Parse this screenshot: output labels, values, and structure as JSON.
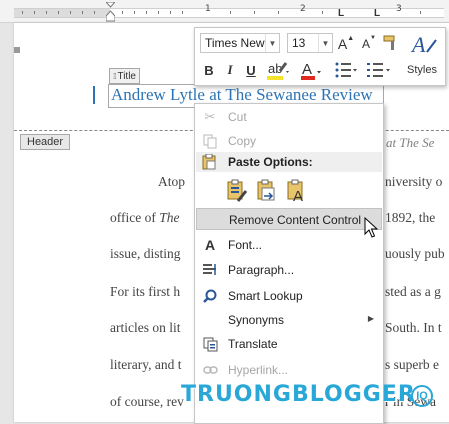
{
  "ruler": {
    "numbers": [
      "1",
      "2",
      "3"
    ],
    "tab_marks": [
      "L",
      "L"
    ]
  },
  "document": {
    "title_tag": "Title",
    "title_text": "Andrew Lytle at The Sewanee Review",
    "header_tag": "Header",
    "header_right": "at The Se",
    "body_lines": [
      {
        "left": "Atop",
        "right": "niversity o"
      },
      {
        "left_pre": "office of ",
        "left_italic": "The",
        "right": "1892, the"
      },
      {
        "left": "issue, disting",
        "right": "uously pub"
      },
      {
        "left": "For its first h",
        "right": "sted as a g"
      },
      {
        "left": "articles on lit",
        "right": "South. In t"
      },
      {
        "left": "literary, and t",
        "right": "s superb e"
      },
      {
        "left": "of course, rev",
        "right": "r in Sewa"
      }
    ]
  },
  "mini_toolbar": {
    "font_name": "Times New Ro",
    "font_size": "13",
    "grow_font": "A",
    "shrink_font": "A",
    "bold": "B",
    "italic": "I",
    "underline": "U",
    "highlight_color": "#f5e22a",
    "font_color": "#e02b20",
    "styles_label": "Styles"
  },
  "context_menu": {
    "items": [
      {
        "label": "Cut",
        "icon": "scissors-icon",
        "enabled": false
      },
      {
        "label": "Copy",
        "icon": "copy-icon",
        "enabled": false
      },
      {
        "label": "Paste Options:",
        "icon": "clipboard-icon",
        "header": true
      },
      {
        "label": "Remove Content Control",
        "icon": "",
        "highlighted": true
      },
      {
        "label": "Font...",
        "icon": "font-icon"
      },
      {
        "label": "Paragraph...",
        "icon": "paragraph-icon"
      },
      {
        "label": "Smart Lookup",
        "icon": "search-icon"
      },
      {
        "label": "Synonyms",
        "icon": "",
        "submenu": true
      },
      {
        "label": "Translate",
        "icon": "translate-icon"
      },
      {
        "label": "Hyperlink...",
        "icon": "link-icon",
        "enabled": false
      }
    ],
    "paste_buttons": [
      "keep-source-formatting",
      "merge-formatting",
      "keep-text-only"
    ]
  },
  "watermark": {
    "text": "TRUONGBLOGGER",
    "color": "#29a8d8"
  },
  "colors": {
    "title_blue": "#2e74b5",
    "accent_blue": "#2b579a"
  }
}
